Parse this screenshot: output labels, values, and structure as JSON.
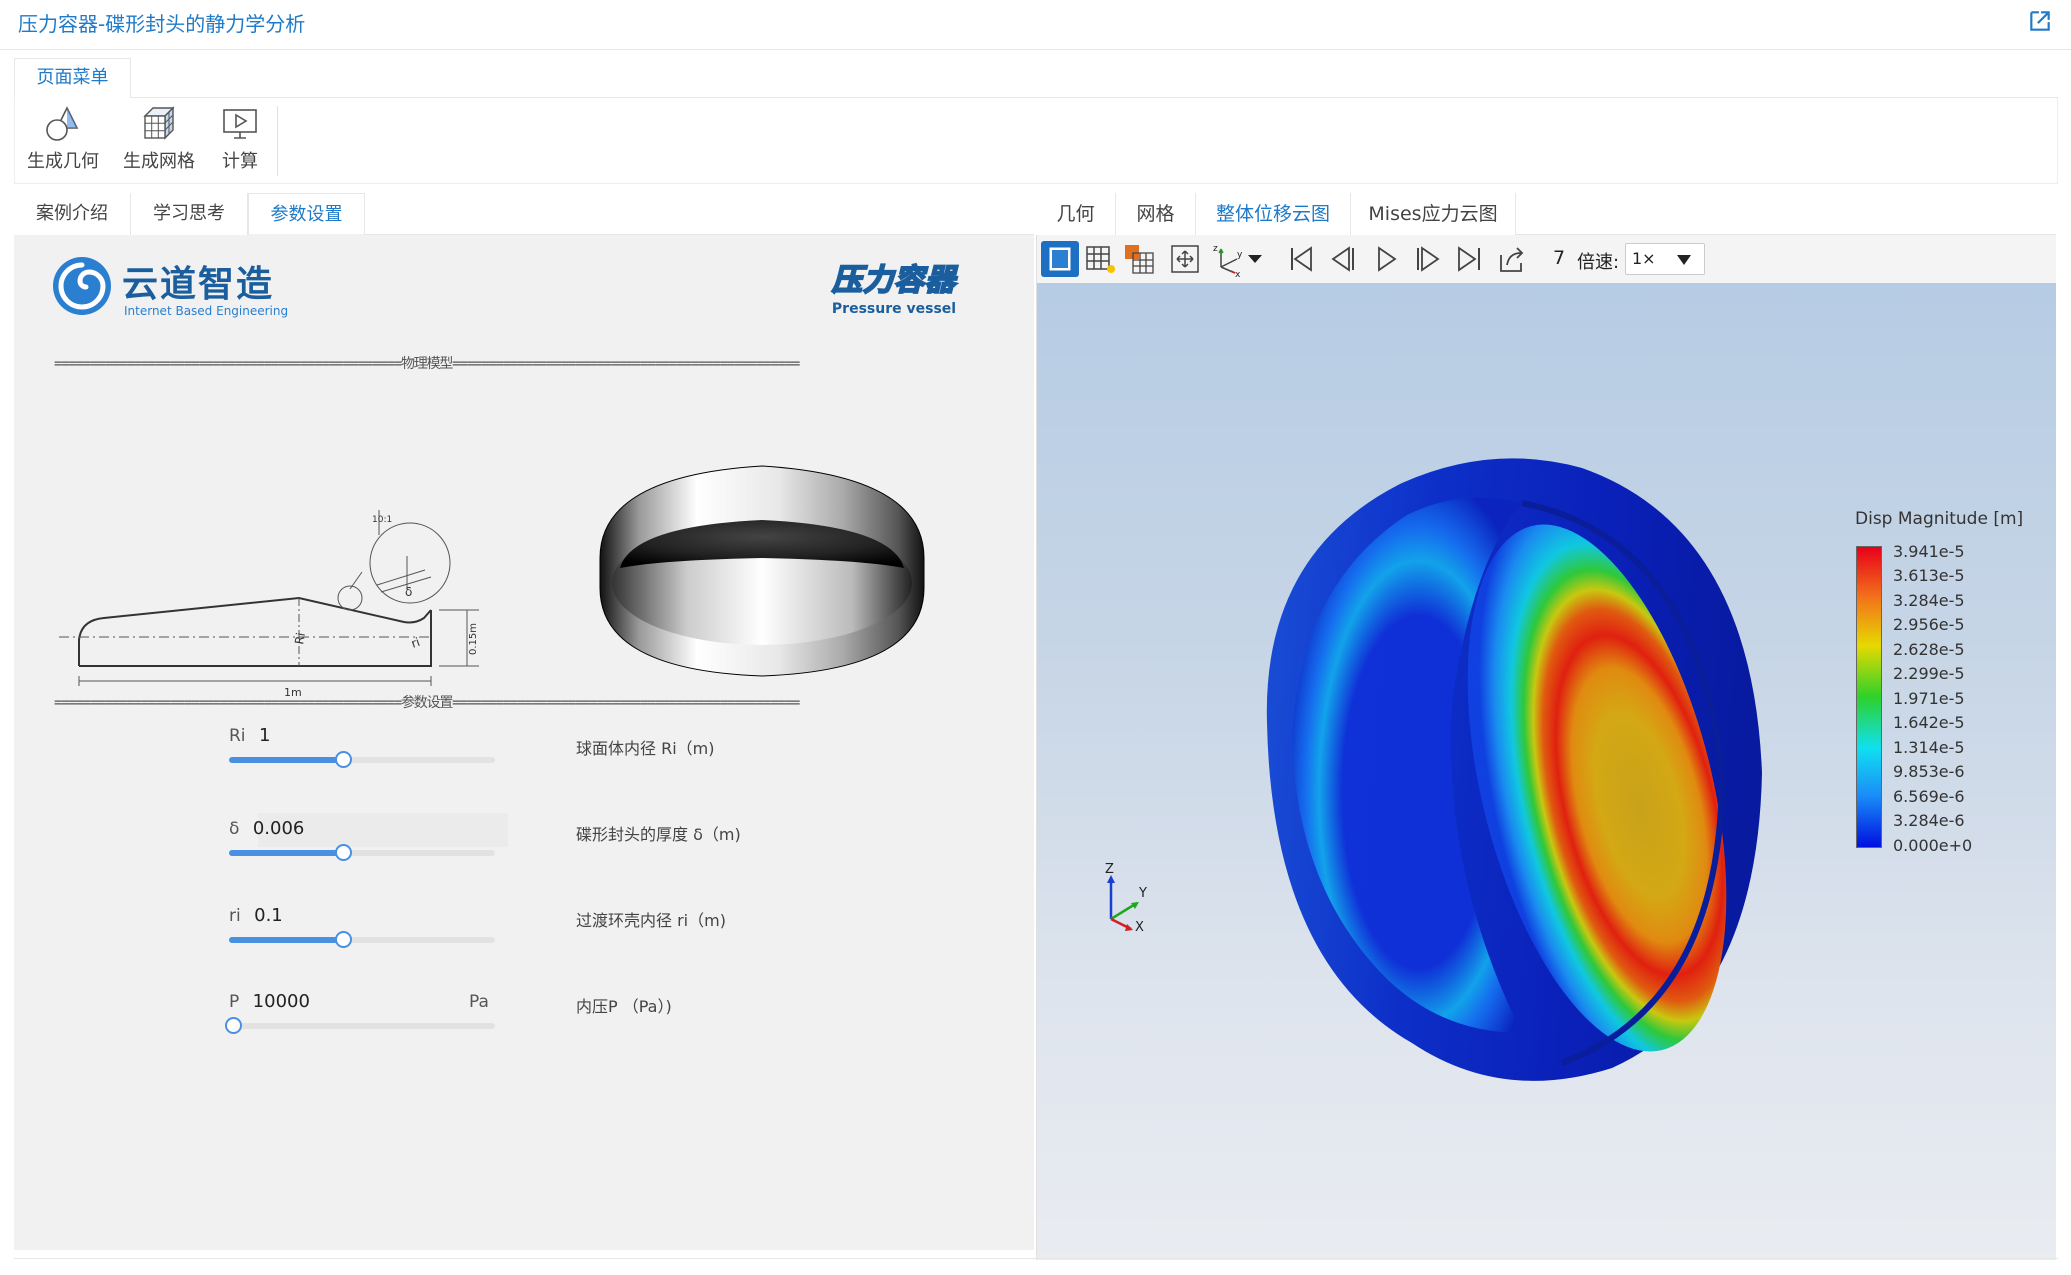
{
  "window": {
    "title": "压力容器-碟形封头的静力学分析",
    "external_icon": "external-link-icon"
  },
  "menu": {
    "tab_label": "页面菜单",
    "tools": [
      {
        "label": "生成几何",
        "icon": "geometry-icon"
      },
      {
        "label": "生成网格",
        "icon": "mesh-cube-icon"
      },
      {
        "label": "计算",
        "icon": "compute-monitor-icon"
      }
    ]
  },
  "left_tabs": [
    "案例介绍",
    "学习思考",
    "参数设置"
  ],
  "left_active_tab": "参数设置",
  "branding": {
    "logo_cn": "云道智造",
    "logo_en": "Internet Based Engineering",
    "product_cn": "压力容器",
    "product_en": "Pressure vessel"
  },
  "sections": {
    "model": "================================================物理模型================================================",
    "params": "================================================参数设置================================================"
  },
  "drawing": {
    "dim_width": "1m",
    "dim_height": "0.15m",
    "label_Ri": "Ri",
    "label_ri": "ri",
    "label_delta": "δ",
    "scale": "10:1"
  },
  "params": [
    {
      "key": "Ri",
      "value": "1",
      "unit": "",
      "desc": "球面体内径 Ri（m)",
      "slider": 0.43
    },
    {
      "key": "δ",
      "value": "0.006",
      "unit": "",
      "desc": "碟形封头的厚度 δ（m)",
      "slider": 0.43
    },
    {
      "key": "ri",
      "value": "0.1",
      "unit": "",
      "desc": "过渡环壳内径 ri（m)",
      "slider": 0.43
    },
    {
      "key": "P",
      "value": "10000",
      "unit": "Pa",
      "desc": "内压P （Pa）)",
      "slider": 0.0
    }
  ],
  "right_tabs": [
    "几何",
    "网格",
    "整体位移云图",
    "Mises应力云图"
  ],
  "right_active_tab": "整体位移云图",
  "viewer_toolbar": {
    "icons": [
      "solid-view-icon",
      "mesh-grid-icon",
      "light-mesh-icon",
      "fit-view-icon",
      "axes-icon",
      "dropdown-arrow-icon",
      "first-frame-icon",
      "prev-frame-icon",
      "play-icon",
      "next-frame-icon",
      "last-frame-icon",
      "export-icon"
    ],
    "frame": "7",
    "speed_label": "倍速:",
    "speed_value": "1×"
  },
  "legend": {
    "title": "Disp Magnitude [m]",
    "values": [
      "3.941e-5",
      "3.613e-5",
      "3.284e-5",
      "2.956e-5",
      "2.628e-5",
      "2.299e-5",
      "1.971e-5",
      "1.642e-5",
      "1.314e-5",
      "9.853e-6",
      "6.569e-6",
      "3.284e-6",
      "0.000e+0"
    ]
  },
  "triad": {
    "z": "Z",
    "y": "Y",
    "x": "X"
  }
}
